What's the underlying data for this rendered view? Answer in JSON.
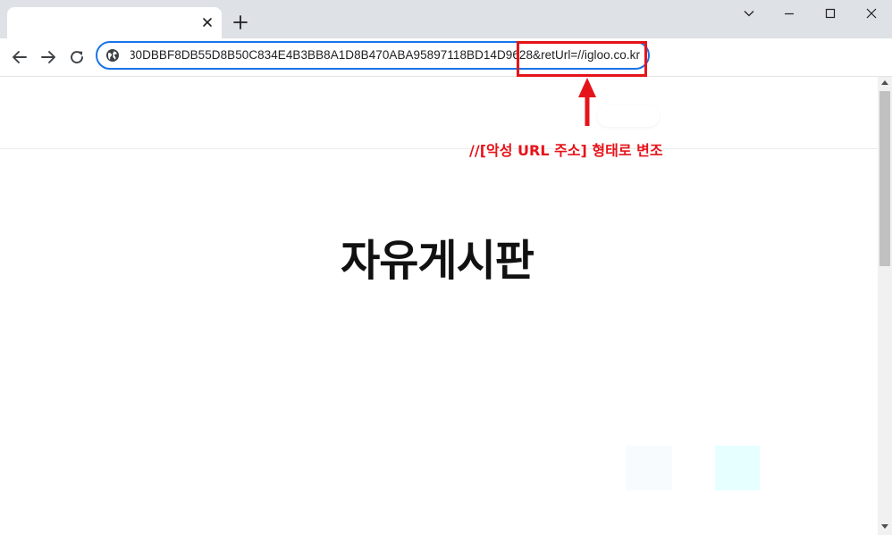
{
  "browser": {
    "tab": {
      "title": ""
    },
    "address_bar": {
      "url_visible": "30DBBF8DB55D8B50C834E4B3BB8A1D8B470ABA95897118BD14D9628&retUrl=//igloo.co.kr"
    }
  },
  "annotation": {
    "text": "//[악성 URL 주소] 형태로 변조",
    "color": "#e5141a"
  },
  "page": {
    "heading": "자유게시판"
  },
  "icons": {
    "site_info": "globe-icon",
    "back": "arrow-left-icon",
    "forward": "arrow-right-icon",
    "reload": "reload-icon",
    "tab_close": "close-icon",
    "new_tab": "plus-icon",
    "tab_search": "chevron-down-icon",
    "minimize": "minimize-icon",
    "maximize": "maximize-icon",
    "window_close": "close-icon"
  },
  "colors": {
    "focus_ring": "#1a73e8",
    "tabstrip": "#dee1e6",
    "annotation_red": "#e5141a"
  }
}
